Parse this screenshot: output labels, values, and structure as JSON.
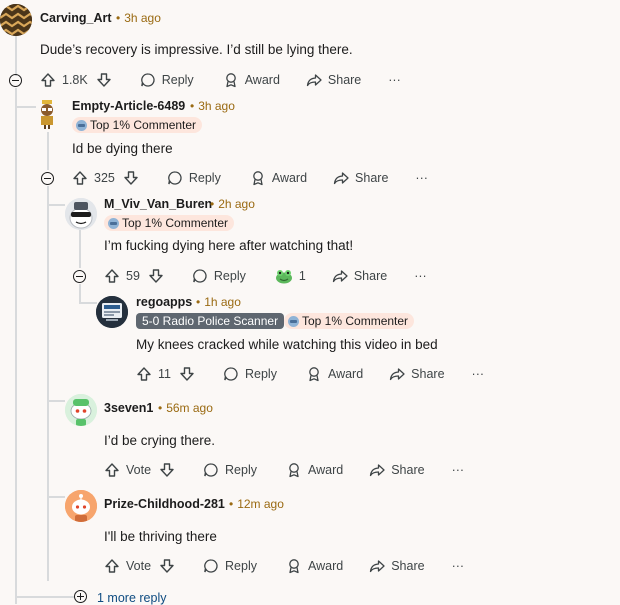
{
  "icons": {
    "upvote": "arrow-up-icon",
    "downvote": "arrow-down-icon",
    "reply": "speech-bubble-icon",
    "award": "award-icon",
    "share": "share-arrow-icon",
    "more": "ellipsis-icon",
    "collapse": "minus-circle-icon",
    "expand": "plus-circle-icon"
  },
  "colors": {
    "timestamp": "#9a6a12",
    "flair_bg": "#fde6dd",
    "thread_line": "#d8dadc",
    "more_link": "#0f4c81"
  },
  "comments": [
    {
      "author": "Carving_Art",
      "time": "3h ago",
      "body": "Dude’s recovery is impressive. I’d still be lying there.",
      "votes": "1.8K",
      "reply": "Reply",
      "award": "Award",
      "share": "Share",
      "more": "···"
    },
    {
      "author": "Empty-Article-6489",
      "time": "3h ago",
      "flair": "Top 1% Commenter",
      "body": "Id be dying there",
      "votes": "325",
      "reply": "Reply",
      "award": "Award",
      "share": "Share",
      "more": "···"
    },
    {
      "author": "M_Viv_Van_Buren",
      "time": "2h ago",
      "flair": "Top 1% Commenter",
      "body": "I’m fucking dying here after watching that!",
      "votes": "59",
      "reply": "Reply",
      "award_count": "1",
      "share": "Share",
      "more": "···"
    },
    {
      "author": "regoapps",
      "time": "1h ago",
      "flair_user": "5-0 Radio Police Scanner",
      "flair": "Top 1% Commenter",
      "body": "My knees cracked while watching this video in bed",
      "votes": "11",
      "reply": "Reply",
      "award": "Award",
      "share": "Share",
      "more": "···"
    },
    {
      "author": "3seven1",
      "time": "56m ago",
      "body": "I’d be crying there.",
      "votes": "Vote",
      "reply": "Reply",
      "award": "Award",
      "share": "Share",
      "more": "···"
    },
    {
      "author": "Prize-Childhood-281",
      "time": "12m ago",
      "body": "I'll be thriving there",
      "votes": "Vote",
      "reply": "Reply",
      "award": "Award",
      "share": "Share",
      "more": "···"
    }
  ],
  "more_replies": "1 more reply"
}
